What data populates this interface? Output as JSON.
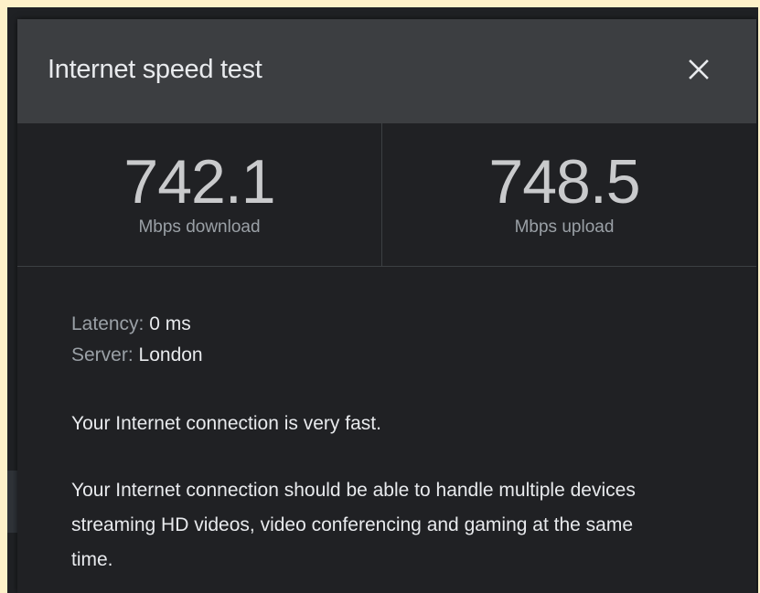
{
  "dialog": {
    "title": "Internet speed test",
    "close_icon": "close-icon"
  },
  "results": {
    "download": {
      "value": "742.1",
      "label": "Mbps download"
    },
    "upload": {
      "value": "748.5",
      "label": "Mbps upload"
    }
  },
  "details": {
    "latency_label": "Latency:",
    "latency_value": "0 ms",
    "server_label": "Server:",
    "server_value": "London"
  },
  "summary": "Your Internet connection is very fast.",
  "description": "Your Internet connection should be able to handle multiple devices streaming HD videos, video conferencing and gaming at the same time.",
  "colors": {
    "page_background": "#fdf1c9",
    "dialog_background": "#202124",
    "header_background": "#3c3e41",
    "primary_text": "#e8eaed",
    "secondary_text": "#9aa0a6"
  }
}
